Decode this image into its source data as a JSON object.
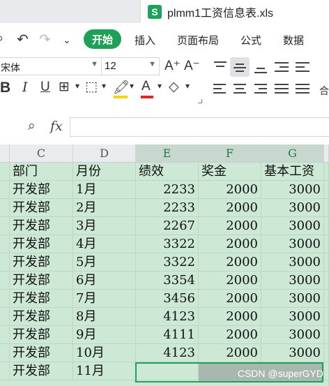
{
  "window": {
    "doc_icon": "S",
    "doc_title": "plmm1工资信息表.xls"
  },
  "menu": {
    "active": "开始",
    "items": [
      "插入",
      "页面布局",
      "公式",
      "数据"
    ]
  },
  "ribbon": {
    "font_name": "宋体",
    "font_size": "12",
    "bold": "B",
    "italic": "I",
    "underline": "U",
    "font_color_glyph": "A",
    "grow_font": "A⁺",
    "shrink_font": "A⁻",
    "wrap_glyph": "合"
  },
  "formula_bar": {
    "fx": "fx",
    "value": ""
  },
  "columns": [
    {
      "letter": "C",
      "selected": false
    },
    {
      "letter": "D",
      "selected": false
    },
    {
      "letter": "E",
      "selected": true
    },
    {
      "letter": "F",
      "selected": true
    },
    {
      "letter": "G",
      "selected": true
    }
  ],
  "table": {
    "headers": [
      "部门",
      "月份",
      "绩效",
      "奖金",
      "基本工资"
    ],
    "rows": [
      [
        "开发部",
        "1月",
        "2233",
        "2000",
        "3000"
      ],
      [
        "开发部",
        "2月",
        "2233",
        "2000",
        "3000"
      ],
      [
        "开发部",
        "3月",
        "2267",
        "2000",
        "3000"
      ],
      [
        "开发部",
        "4月",
        "3322",
        "2000",
        "3000"
      ],
      [
        "开发部",
        "5月",
        "3322",
        "2000",
        "3000"
      ],
      [
        "开发部",
        "6月",
        "3354",
        "2000",
        "3000"
      ],
      [
        "开发部",
        "7月",
        "3456",
        "2000",
        "3000"
      ],
      [
        "开发部",
        "8月",
        "4123",
        "2000",
        "3000"
      ],
      [
        "开发部",
        "9月",
        "4111",
        "2000",
        "3000"
      ],
      [
        "开发部",
        "10月",
        "4123",
        "2000",
        "3000"
      ],
      [
        "开发部",
        "11月",
        "",
        "",
        ""
      ]
    ]
  },
  "watermark": "CSDN @superGYD",
  "colors": {
    "accent": "#1fa058",
    "cell_fill": "#cde8d4",
    "selection_fill": "#a9b8ae"
  }
}
